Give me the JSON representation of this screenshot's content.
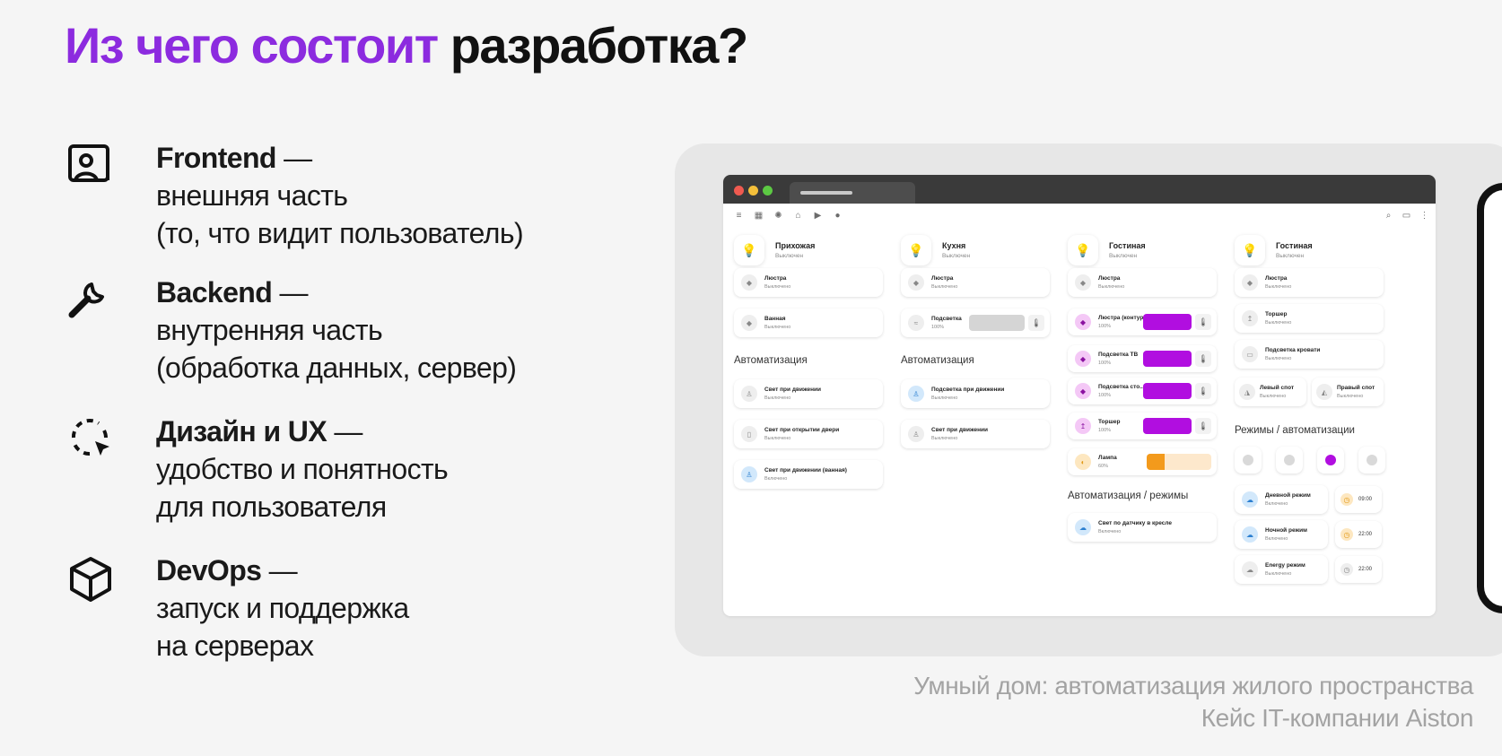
{
  "title": {
    "accent": "Из чего состоит",
    "rest": " разработка?"
  },
  "features": [
    {
      "icon": "user-card-icon",
      "name": "Frontend",
      "dash": " —",
      "lines": [
        "внешняя часть",
        "(то, что видит пользователь)"
      ]
    },
    {
      "icon": "wrench-icon",
      "name": "Backend",
      "dash": " —",
      "lines": [
        "внутренняя часть",
        "(обработка данных, сервер)"
      ]
    },
    {
      "icon": "cursor-select-icon",
      "name": "Дизайн и UX",
      "dash": " —",
      "lines": [
        "удобство и понятность",
        "для пользователя"
      ]
    },
    {
      "icon": "cube-icon",
      "name": "DevOps ",
      "dash": " —",
      "lines": [
        "запуск и поддержка",
        "на серверах"
      ]
    }
  ],
  "caption": {
    "line1": "Умный дом: автоматизация жилого пространства",
    "line2": "Кейс IT-компании Aiston"
  },
  "app": {
    "rooms": [
      {
        "name": "Прихожая",
        "status": "Выключен"
      },
      {
        "name": "Кухня",
        "status": "Выключен"
      },
      {
        "name": "Гостиная",
        "status": "Выключен"
      },
      {
        "name": "Гостиная",
        "status": "Выключен"
      }
    ],
    "col1": {
      "devices": [
        {
          "name": "Люстра",
          "status": "Выключено"
        },
        {
          "name": "Ванная",
          "status": "Выключено"
        }
      ],
      "section": "Автоматизация",
      "automations": [
        {
          "name": "Свет при движении",
          "status": "Выключено"
        },
        {
          "name": "Свет при открытии двери",
          "status": "Выключено"
        },
        {
          "name": "Свет при движении (ванная)",
          "status": "Включено"
        }
      ]
    },
    "col2": {
      "devices": [
        {
          "name": "Люстра",
          "status": "Выключено"
        },
        {
          "name": "Подсветка",
          "status": "100%"
        }
      ],
      "section": "Автоматизация",
      "automations": [
        {
          "name": "Подсветка при движении",
          "status": "Выключено"
        },
        {
          "name": "Свет при движении",
          "status": "Выключено"
        }
      ]
    },
    "col3": {
      "devices": [
        {
          "name": "Люстра",
          "status": "Выключено"
        },
        {
          "name": "Люстра (контур)",
          "status": "100%",
          "level": 1.0
        },
        {
          "name": "Подсветка ТВ",
          "status": "100%",
          "level": 1.0
        },
        {
          "name": "Подсветка сто...",
          "status": "100%",
          "level": 1.0
        },
        {
          "name": "Торшер",
          "status": "100%",
          "level": 1.0
        },
        {
          "name": "Лампа",
          "status": "60%",
          "level": 0.28
        }
      ],
      "section": "Автоматизация / режимы",
      "automations": [
        {
          "name": "Свет по датчику в кресле",
          "status": "Включено"
        }
      ]
    },
    "col4": {
      "devices": [
        {
          "name": "Люстра",
          "status": "Выключено"
        },
        {
          "name": "Торшер",
          "status": "Выключено"
        },
        {
          "name": "Подсветка кровати",
          "status": "Выключено"
        },
        {
          "name": "Левый спот",
          "status": "Выключено"
        },
        {
          "name": "Правый спот",
          "status": "Выключено"
        }
      ],
      "section": "Режимы / автоматизации",
      "modes": [
        {
          "name": "Дневной режим",
          "status": "Включено",
          "time": "09:00"
        },
        {
          "name": "Ночной режим",
          "status": "Включено",
          "time": "22:00"
        },
        {
          "name": "Energy режим",
          "status": "Выключено",
          "time": "22:00"
        }
      ]
    }
  }
}
